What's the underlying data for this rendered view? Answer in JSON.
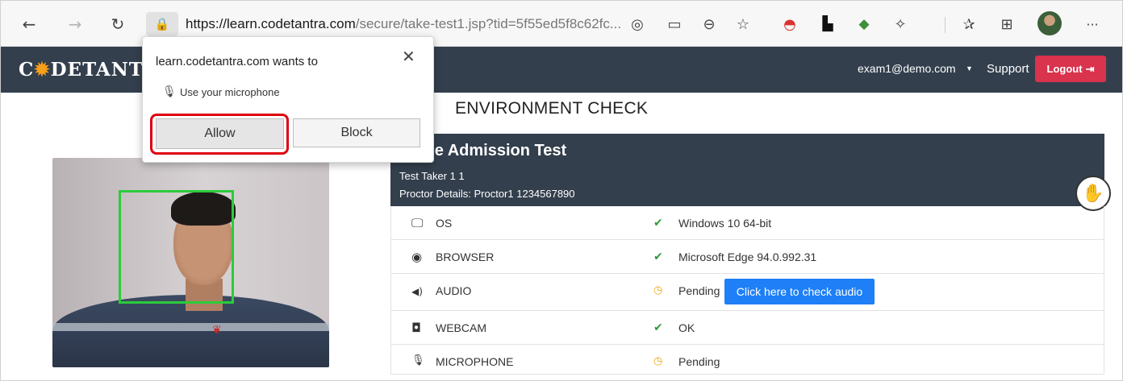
{
  "browser": {
    "url_host": "https://learn.codetantra.com",
    "url_rest": "/secure/take-test1.jsp?tid=5f55ed5f8c62fc...",
    "icons": {
      "back": "←",
      "forward": "→",
      "refresh": "↻",
      "lock": "🔒",
      "location": "◎",
      "camera": "▭",
      "zoom": "⊖",
      "favorite": "☆",
      "pokeball": "◓",
      "doc": "▙",
      "ext": "◆",
      "puzzle": "✧",
      "favorites": "✰",
      "collections": "⊞",
      "more": "···"
    }
  },
  "app": {
    "logo_pre": "C",
    "logo_gear": "✹",
    "logo_post": "DETANT",
    "user_email": "exam1@demo.com",
    "caret": "▼",
    "support": "Support",
    "logout": "Logout",
    "logout_icon": "⇥"
  },
  "page": {
    "heading": "ENVIRONMENT CHECK"
  },
  "test": {
    "title": "ple Admission Test",
    "taker": "Test Taker 1 1",
    "proctor": "Proctor Details: Proctor1 1234567890",
    "raise_hand_icon": "✋"
  },
  "checks": [
    {
      "icon": "🖵",
      "label": "OS",
      "status_icon": "✔",
      "status": "ok",
      "value": "Windows 10 64-bit"
    },
    {
      "icon": "◉",
      "label": "BROWSER",
      "status_icon": "✔",
      "status": "ok",
      "value": "Microsoft Edge 94.0.992.31"
    },
    {
      "icon": "◀)",
      "label": "AUDIO",
      "status_icon": "◷",
      "status": "pending",
      "value": "Pending",
      "button": "Click here to check audio"
    },
    {
      "icon": "◘",
      "label": "WEBCAM",
      "status_icon": "✔",
      "status": "ok",
      "value": "OK"
    },
    {
      "icon": "🎙",
      "label": "MICROPHONE",
      "status_icon": "◷",
      "status": "pending",
      "value": "Pending"
    }
  ],
  "popup": {
    "title": "learn.codetantra.com wants to",
    "close_icon": "✕",
    "mic_icon": "🎙",
    "permission": "Use your microphone",
    "allow": "Allow",
    "block": "Block"
  },
  "colors": {
    "appbar": "#333f4d",
    "logout": "#d9334d",
    "accent_blue": "#1e7ff7",
    "ok_green": "#2e9b3c",
    "pending_orange": "#f0a30a",
    "highlight_red": "#e0000f",
    "face_box": "#2bcc3a"
  }
}
